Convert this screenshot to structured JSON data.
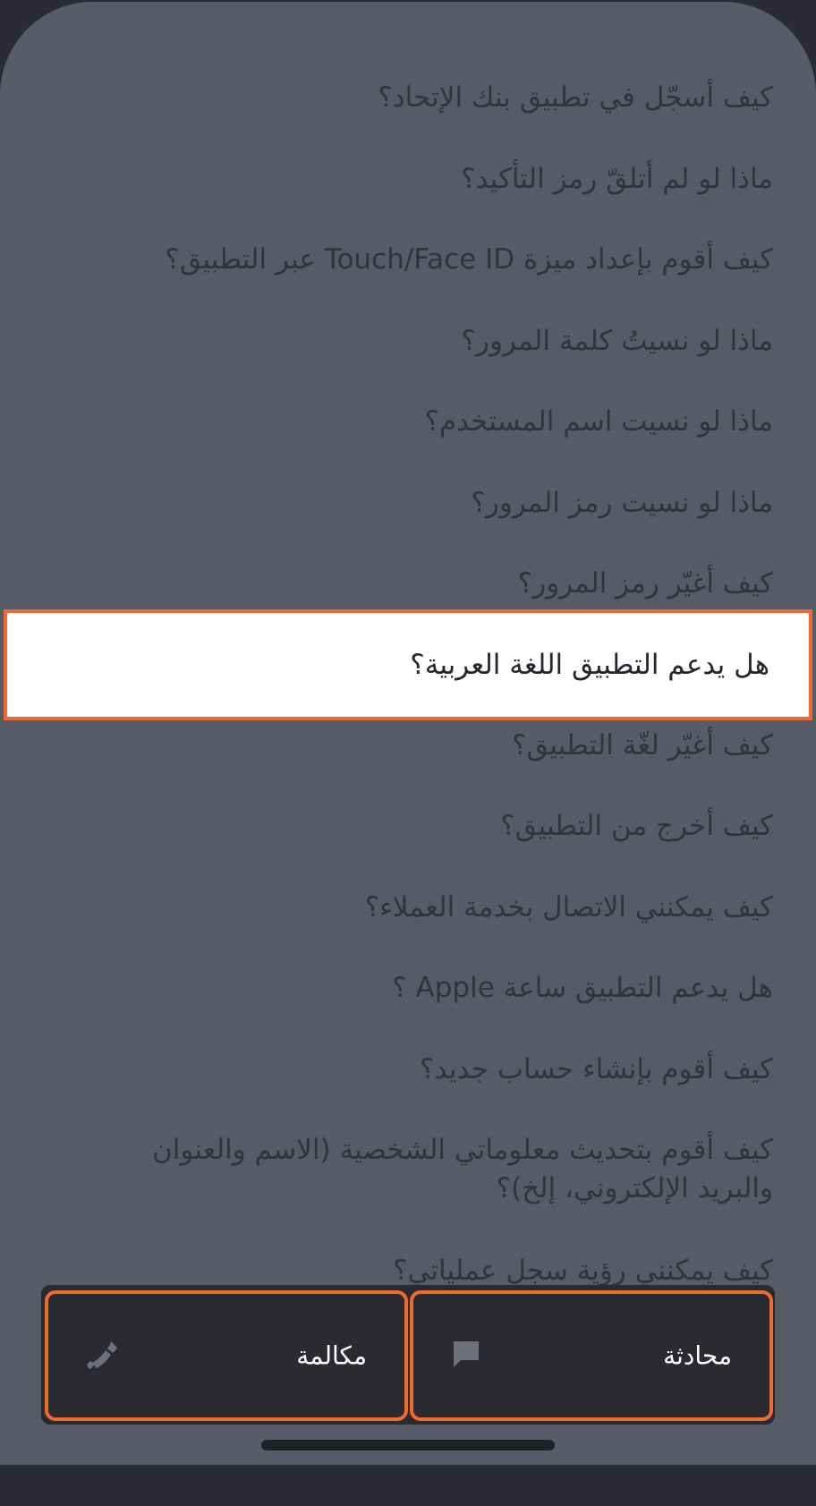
{
  "faq": {
    "items": [
      "كيف أسجّل في تطبيق بنك الإتحاد؟",
      "ماذا لو لم أتلقّ رمز التأكيد؟",
      "كيف أقوم بإعداد ميزة Touch/Face ID عبر التطبيق؟",
      "ماذا لو نسيتُ كلمة المرور؟",
      "ماذا لو نسيت اسم المستخدم؟",
      "ماذا لو نسيت رمز المرور؟",
      "كيف أغيّر رمز المرور؟",
      "هل يدعم التطبيق اللغة العربية؟",
      "كيف أغيّر لغّة التطبيق؟",
      "كيف أخرج من التطبيق؟",
      "كيف يمكنني الاتصال بخدمة العملاء؟",
      "هل يدعم التطبيق ساعة Apple ؟",
      "كيف أقوم بإنشاء حساب جديد؟",
      "كيف أقوم بتحديث معلوماتي الشخصية (الاسم والعنوان والبريد الإلكتروني، إلخ)؟",
      "كيف يمكنني رؤية سجل عملياتي؟"
    ],
    "selected_index": 7
  },
  "actions": {
    "chat_label": "محادثة",
    "call_label": "مكالمة"
  },
  "colors": {
    "sheet": "#595a67",
    "text": "#32333c",
    "highlight_border": "#ee6a2e",
    "button_bg": "#2a2b31"
  }
}
